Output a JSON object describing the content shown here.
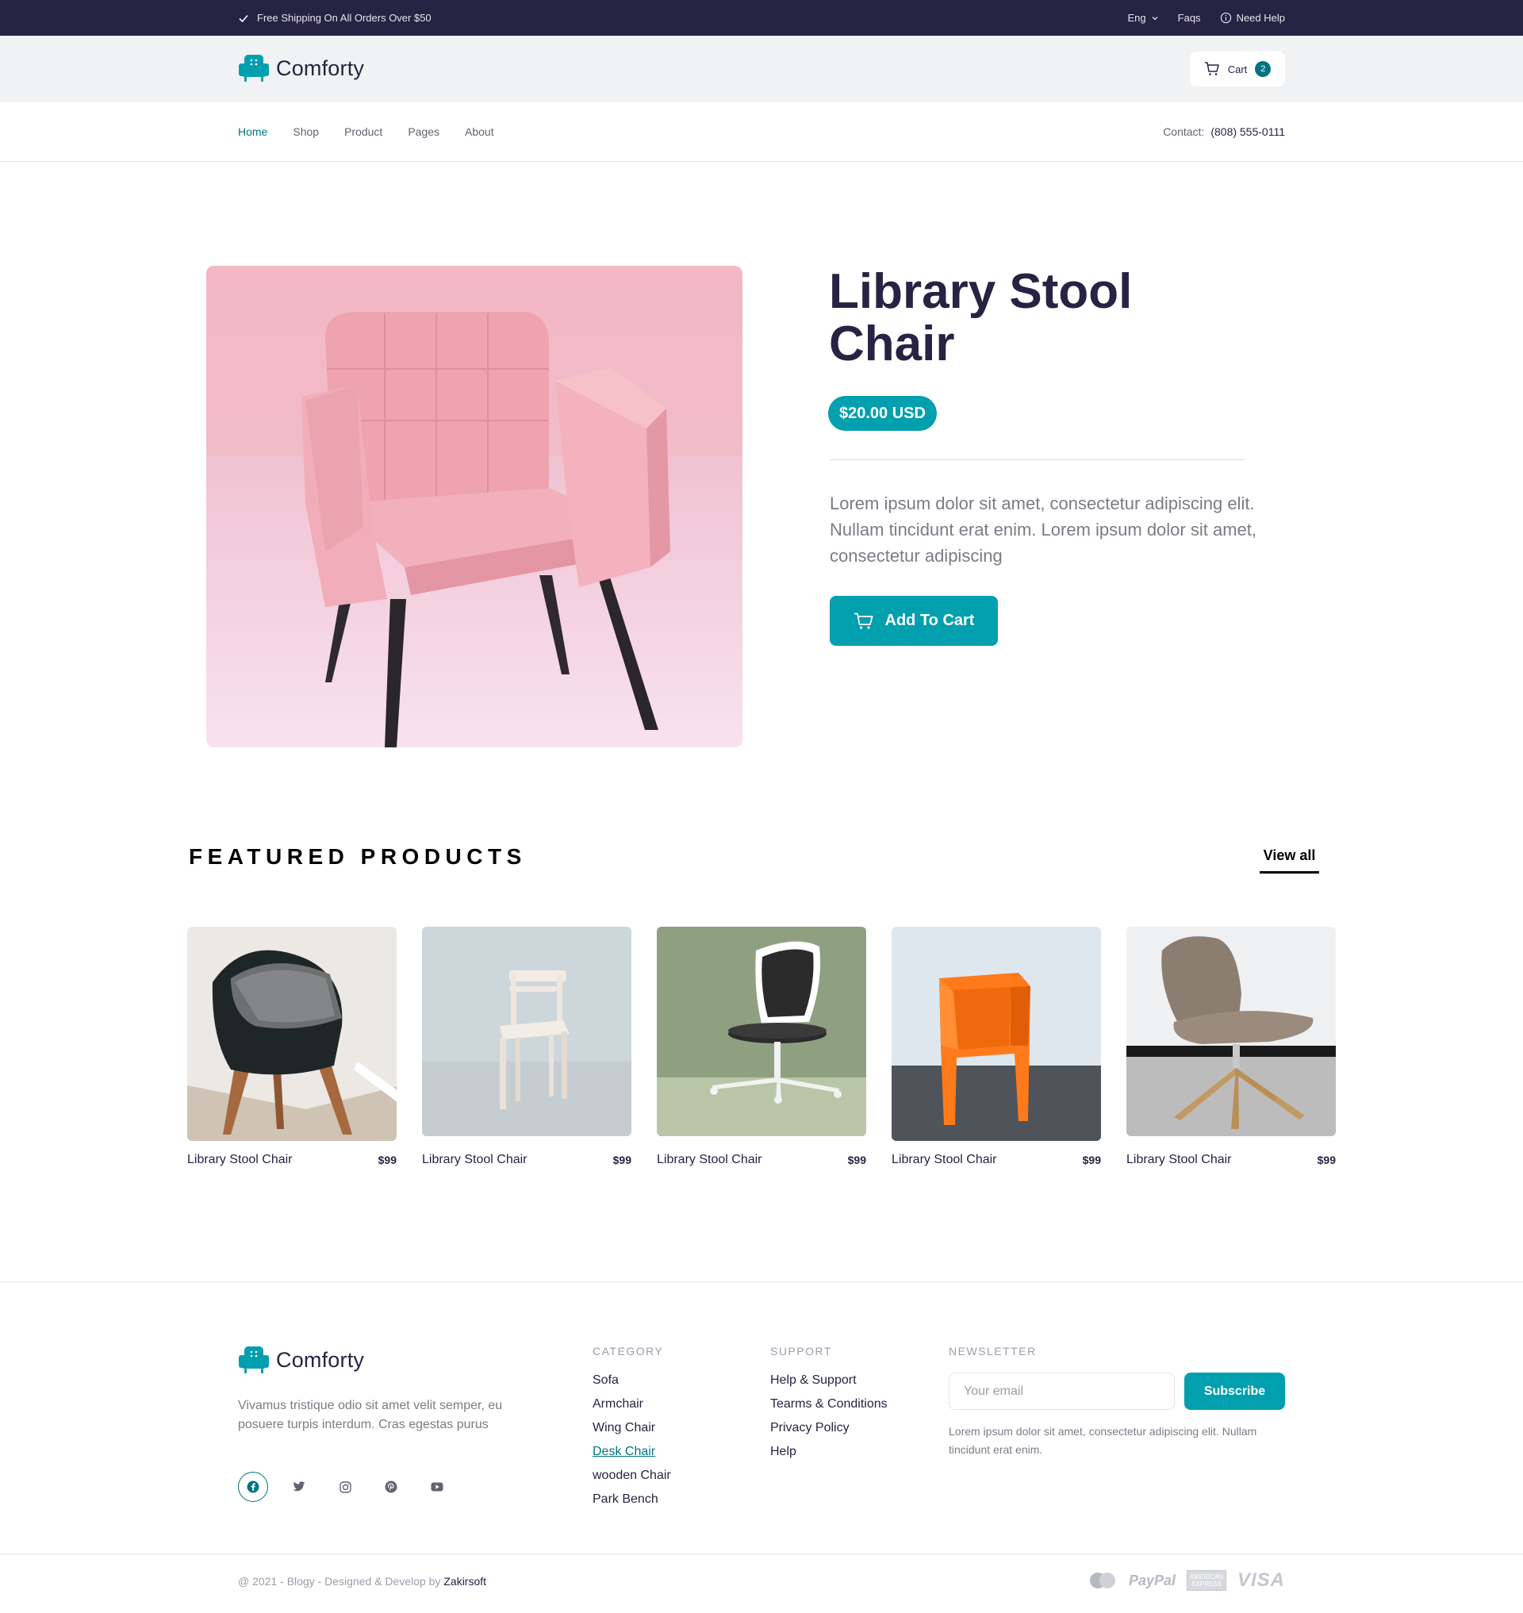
{
  "topbar": {
    "shipping_text": "Free Shipping On All Orders Over $50",
    "language": "Eng",
    "faqs": "Faqs",
    "help": "Need Help"
  },
  "header": {
    "brand": "Comforty",
    "cart_label": "Cart",
    "cart_count": "2"
  },
  "nav": {
    "items": [
      {
        "label": "Home",
        "active": true
      },
      {
        "label": "Shop",
        "active": false
      },
      {
        "label": "Product",
        "active": false
      },
      {
        "label": "Pages",
        "active": false
      },
      {
        "label": "About",
        "active": false
      }
    ],
    "contact_label": "Contact:",
    "contact_phone": "(808) 555-0111"
  },
  "product": {
    "title": "Library Stool Chair",
    "price": "$20.00 USD",
    "description": "Lorem ipsum dolor sit amet, consectetur adipiscing elit. Nullam tincidunt erat enim. Lorem ipsum dolor sit amet, consectetur adipiscing",
    "add_to_cart": "Add To Cart"
  },
  "featured": {
    "title": "FEATURED PRODUCTS",
    "view_all": "View all",
    "items": [
      {
        "name": "Library Stool Chair",
        "price": "$99"
      },
      {
        "name": "Library Stool Chair",
        "price": "$99"
      },
      {
        "name": "Library Stool Chair",
        "price": "$99"
      },
      {
        "name": "Library Stool Chair",
        "price": "$99"
      },
      {
        "name": "Library Stool Chair",
        "price": "$99"
      }
    ]
  },
  "footer": {
    "brand": "Comforty",
    "description": "Vivamus tristique odio sit amet velit semper, eu posuere turpis interdum. Cras egestas purus",
    "socials": [
      "facebook-icon",
      "twitter-icon",
      "instagram-icon",
      "pinterest-icon",
      "youtube-icon"
    ],
    "category": {
      "heading": "CATEGORY",
      "links": [
        "Sofa",
        "Armchair",
        "Wing Chair",
        "Desk Chair",
        "wooden Chair",
        "Park Bench"
      ]
    },
    "support": {
      "heading": "SUPPORT",
      "links": [
        "Help & Support",
        "Tearms & Conditions",
        "Privacy Policy",
        "Help"
      ]
    },
    "newsletter": {
      "heading": "NEWSLETTER",
      "placeholder": "Your email",
      "button": "Subscribe",
      "description": "Lorem ipsum dolor sit amet, consectetur adipiscing elit. Nullam tincidunt erat enim."
    },
    "copyright_prefix": "@ 2021 - Blogy - Designed & Develop by",
    "copyright_brand": "Zakirsoft",
    "payments": {
      "paypal": "PayPal",
      "amex": "AMERICAN EXPRESS",
      "visa": "VISA"
    }
  },
  "colors": {
    "primary": "#029FAE",
    "dark": "#272343",
    "accent": "#007580",
    "topbar_bg": "#272343",
    "header_bg": "#F0F2F3"
  }
}
